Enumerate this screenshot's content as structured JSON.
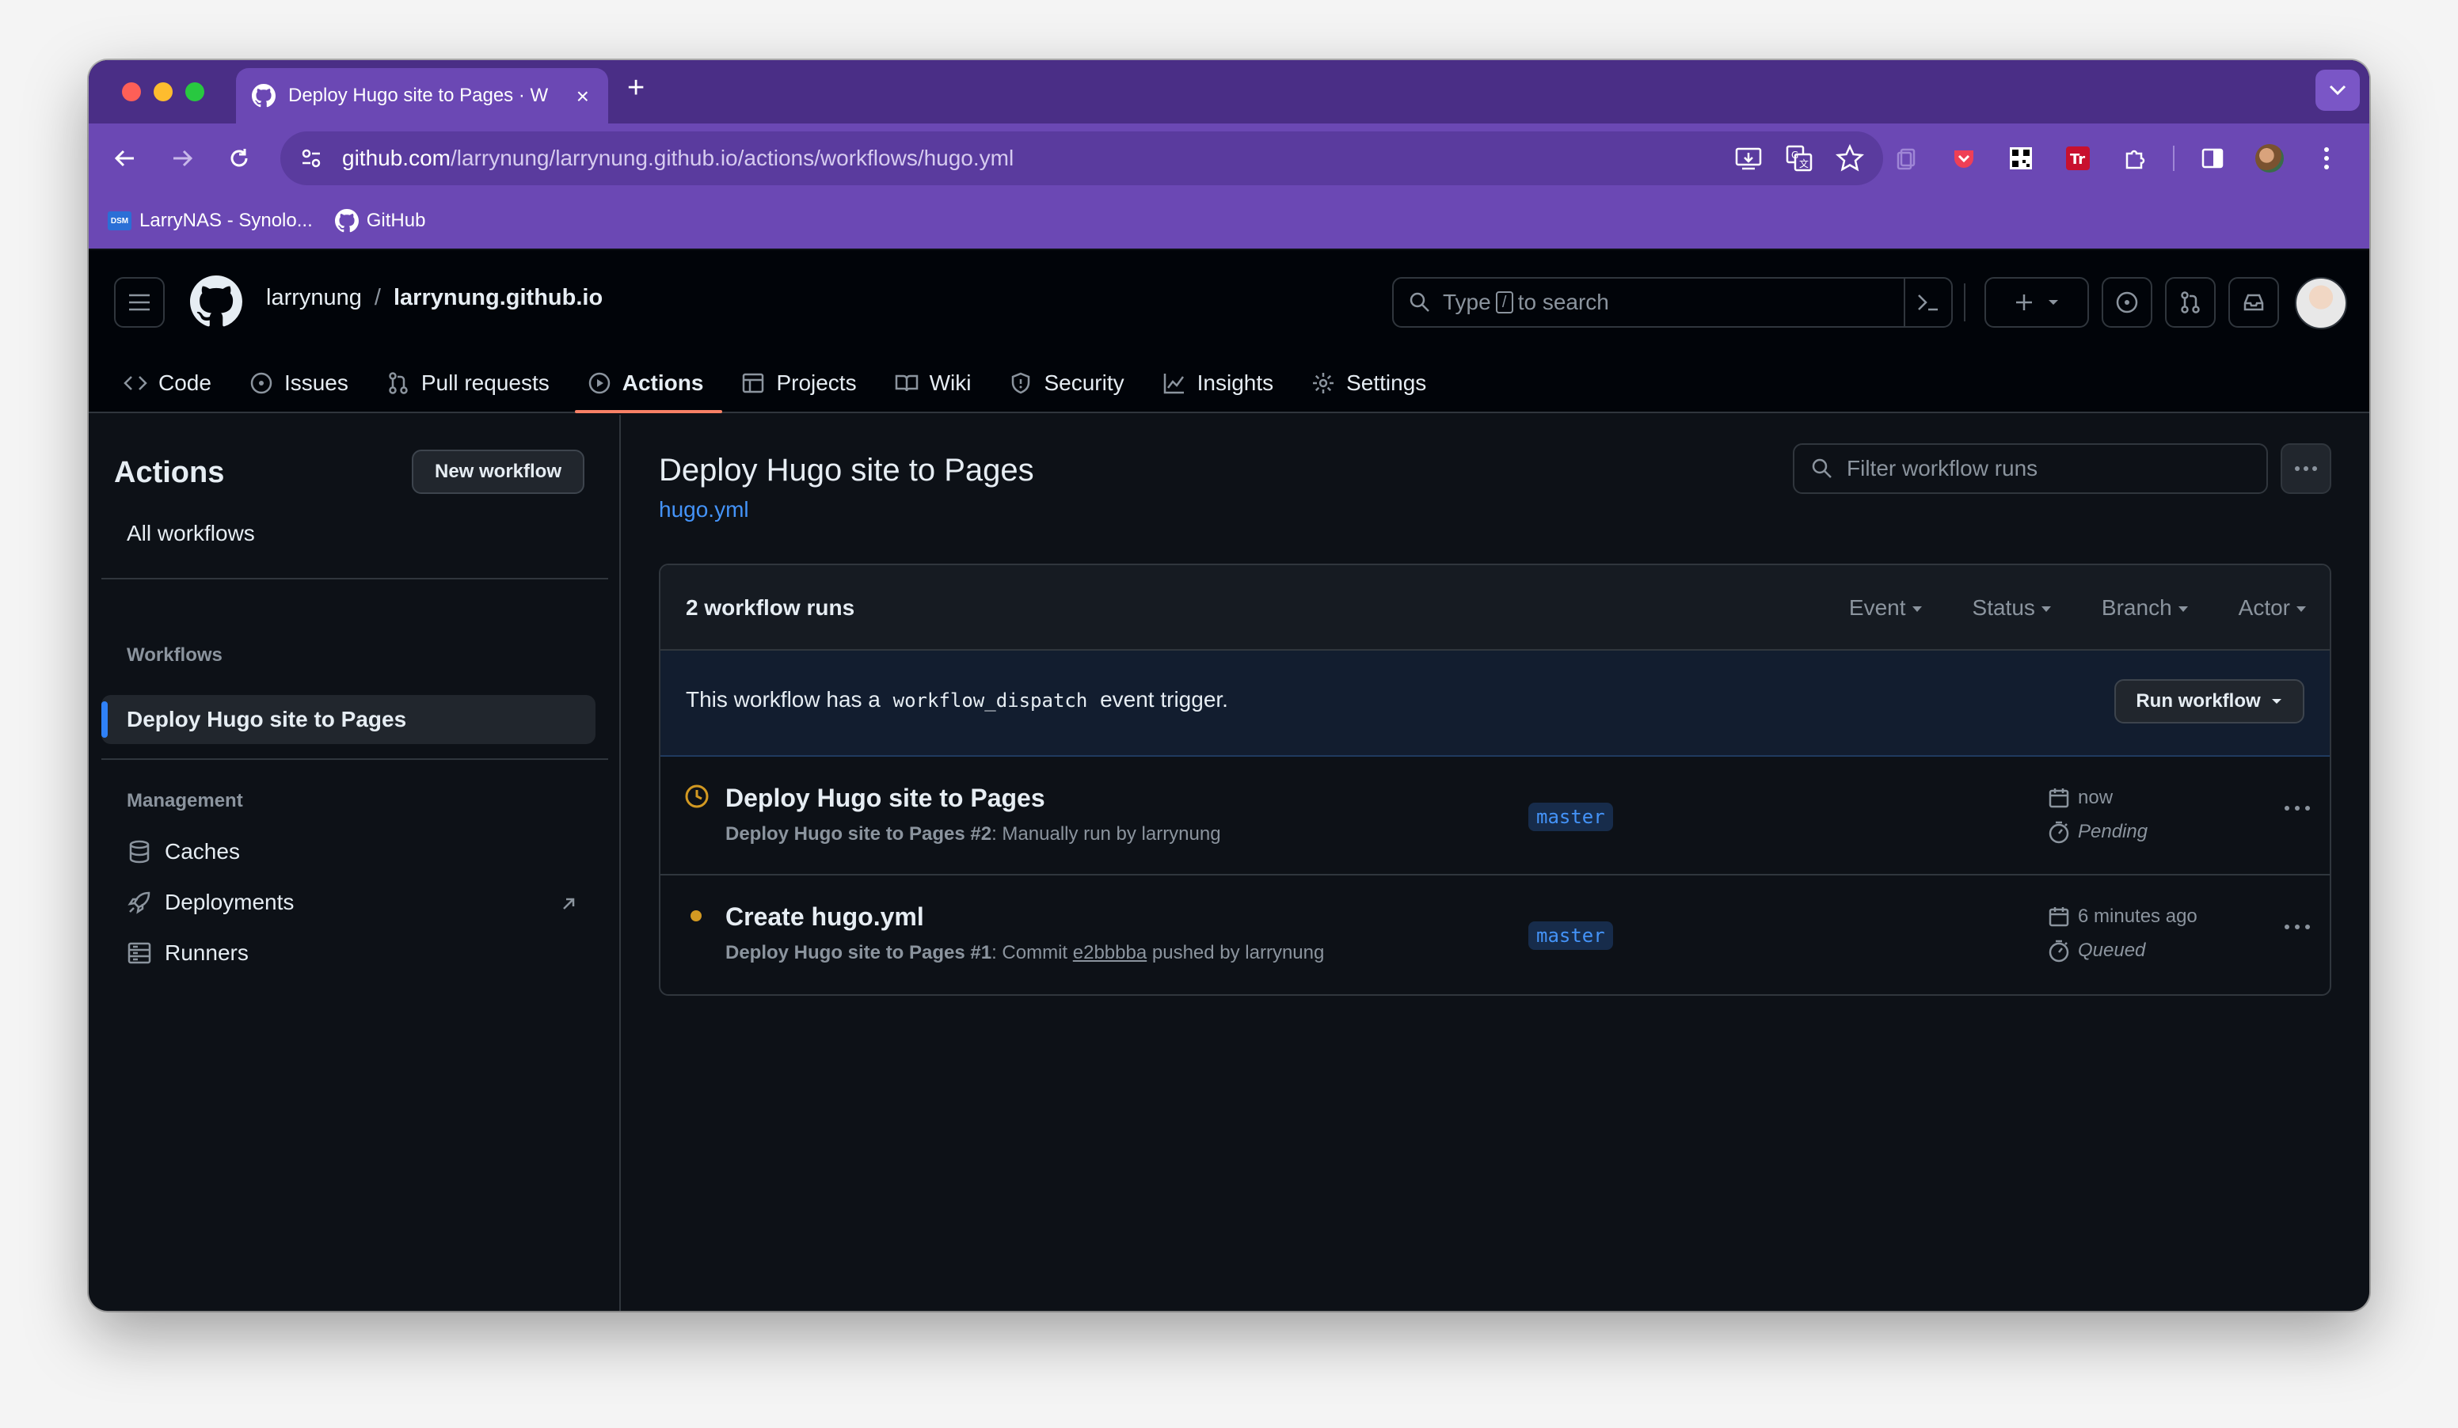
{
  "browser": {
    "tab_title": "Deploy Hugo site to Pages · W",
    "url_host": "github.com",
    "url_path": "/larrynung/larrynung.github.io/actions/workflows/hugo.yml",
    "bookmarks": [
      {
        "label": "LarryNAS - Synolo...",
        "icon": "dsm-icon"
      },
      {
        "label": "GitHub",
        "icon": "github-icon"
      }
    ]
  },
  "header": {
    "owner": "larrynung",
    "separator": "/",
    "repo": "larrynung.github.io",
    "search_prefix": "Type",
    "search_key": "/",
    "search_suffix": "to search"
  },
  "repo_nav": [
    {
      "label": "Code",
      "icon": "code-icon"
    },
    {
      "label": "Issues",
      "icon": "issue-icon"
    },
    {
      "label": "Pull requests",
      "icon": "pull-request-icon"
    },
    {
      "label": "Actions",
      "icon": "play-icon",
      "active": true
    },
    {
      "label": "Projects",
      "icon": "table-icon"
    },
    {
      "label": "Wiki",
      "icon": "book-icon"
    },
    {
      "label": "Security",
      "icon": "shield-icon"
    },
    {
      "label": "Insights",
      "icon": "graph-icon"
    },
    {
      "label": "Settings",
      "icon": "gear-icon"
    }
  ],
  "sidebar": {
    "title": "Actions",
    "new_workflow": "New workflow",
    "all_workflows": "All workflows",
    "workflows_heading": "Workflows",
    "selected_workflow": "Deploy Hugo site to Pages",
    "management_heading": "Management",
    "management": [
      {
        "label": "Caches",
        "icon": "database-icon"
      },
      {
        "label": "Deployments",
        "icon": "rocket-icon"
      },
      {
        "label": "Runners",
        "icon": "server-icon"
      }
    ]
  },
  "main": {
    "title": "Deploy Hugo site to Pages",
    "file": "hugo.yml",
    "filter_placeholder": "Filter workflow runs",
    "runs_count": "2 workflow runs",
    "filters": [
      "Event",
      "Status",
      "Branch",
      "Actor"
    ],
    "dispatch_prefix": "This workflow has a",
    "dispatch_code": "workflow_dispatch",
    "dispatch_suffix": "event trigger.",
    "run_workflow": "Run workflow",
    "runs": [
      {
        "title": "Deploy Hugo site to Pages",
        "workflow": "Deploy Hugo site to Pages",
        "number": "#2",
        "detail": ": Manually run by larrynung",
        "branch": "master",
        "time": "now",
        "state": "Pending",
        "status_icon": "clock-icon",
        "status_color": "#d29922"
      },
      {
        "title": "Create hugo.yml",
        "workflow": "Deploy Hugo site to Pages",
        "number": "#1",
        "detail_prefix": ": Commit",
        "commit": "e2bbbba",
        "detail_suffix": "pushed by larrynung",
        "branch": "master",
        "time": "6 minutes ago",
        "state": "Queued",
        "status_icon": "dot-icon",
        "status_color": "#d29922"
      }
    ]
  },
  "colors": {
    "chrome_purple": "#6b48b4",
    "gh_bg": "#0d1117",
    "accent_underline": "#f78166",
    "link_blue": "#4493f8"
  }
}
